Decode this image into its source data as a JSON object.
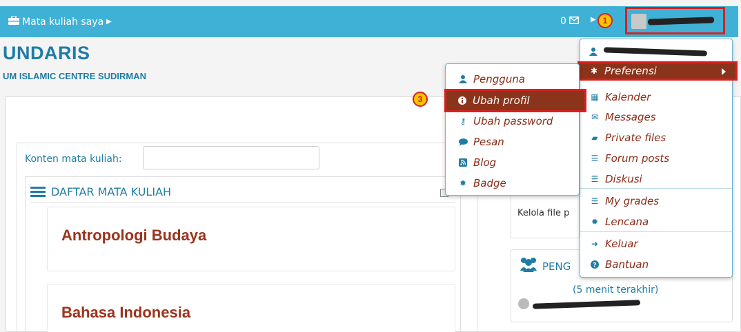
{
  "nav": {
    "my_courses": "Mata kuliah saya",
    "message_count": "0"
  },
  "brand": {
    "title": "UNDARIS",
    "subtitle": "UM ISLAMIC CENTRE SUDIRMAN"
  },
  "badges": [
    "1",
    "2",
    "3"
  ],
  "search": {
    "label": "Konten mata kuliah:",
    "value": ""
  },
  "course_list": {
    "title": "DAFTAR MATA KULIAH",
    "courses": [
      "Antropologi Budaya",
      "Bahasa Indonesia"
    ]
  },
  "side": {
    "private_files_text": "Kelola file p",
    "online_title": "PENG",
    "online_note": "(5 menit terakhir)"
  },
  "user_menu": {
    "items": [
      {
        "label": "Preferensi",
        "icon": "gear-icon"
      },
      {
        "label": "Kalender",
        "icon": "calendar-icon"
      },
      {
        "label": "Messages",
        "icon": "envelope-icon"
      },
      {
        "label": "Private files",
        "icon": "file-icon"
      },
      {
        "label": "Forum posts",
        "icon": "list-icon"
      },
      {
        "label": "Diskusi",
        "icon": "list-icon"
      },
      {
        "label": "My grades",
        "icon": "table-icon"
      },
      {
        "label": "Lencana",
        "icon": "badge-icon"
      },
      {
        "label": "Keluar",
        "icon": "signout-icon"
      },
      {
        "label": "Bantuan",
        "icon": "help-icon"
      }
    ]
  },
  "pref_menu": {
    "items": [
      {
        "label": "Pengguna",
        "icon": "user-icon"
      },
      {
        "label": "Ubah profil",
        "icon": "info-icon"
      },
      {
        "label": "Ubah password",
        "icon": "key-icon"
      },
      {
        "label": "Pesan",
        "icon": "chat-icon"
      },
      {
        "label": "Blog",
        "icon": "rss-icon"
      },
      {
        "label": "Badge",
        "icon": "badge-icon"
      }
    ]
  },
  "colors": {
    "navbar": "#3fb1d6",
    "brand": "#1f7ca6",
    "course_title": "#9b331c",
    "highlight": "#d9201f",
    "active_item": "#8b341c"
  }
}
